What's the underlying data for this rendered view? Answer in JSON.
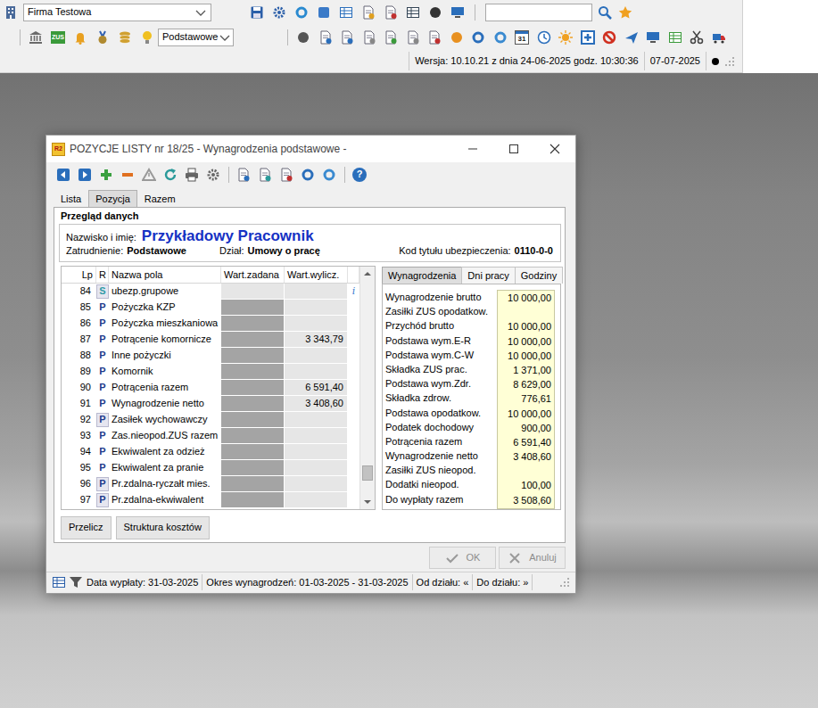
{
  "app": {
    "company": "Firma Testowa",
    "search": {
      "value": ""
    },
    "icon_texts": {
      "zus": "ZUS",
      "calendar": "31"
    },
    "view": "Podstawowe",
    "version": "Wersja: 10.10.21 z dnia 24-06-2025 godz. 10:30:36",
    "date": "07-07-2025"
  },
  "window": {
    "logo": "R2",
    "title": "POZYCJE LISTY nr 18/25 - Wynagrodzenia podstawowe -",
    "help": "?"
  },
  "tabs": [
    {
      "label": "Lista",
      "selected": false
    },
    {
      "label": "Pozycja",
      "selected": true
    },
    {
      "label": "Razem",
      "selected": false
    }
  ],
  "panel": {
    "title": "Przegląd danych"
  },
  "employee": {
    "name_label": "Nazwisko i imię:",
    "name": "Przykładowy Pracownik",
    "employment_label": "Zatrudnienie:",
    "employment": "Podstawowe",
    "department_label": "Dział:",
    "department": "Umowy o pracę",
    "code_label": "Kod tytułu ubezpieczenia:",
    "code": "0110-0-0"
  },
  "table": {
    "columns": [
      "Lp",
      "R",
      "Nazwa pola",
      "Wart.zadana",
      "Wart.wylicz."
    ],
    "rows": [
      {
        "lp": "84",
        "r": "S",
        "color": "#2f9aa6",
        "boxed": true,
        "name": "ubezp.grupowe",
        "set": "",
        "set_disabled": false,
        "calc": "",
        "note": "i"
      },
      {
        "lp": "85",
        "r": "P",
        "color": "#1b3a8c",
        "boxed": false,
        "name": "Pożyczka KZP",
        "set": "",
        "set_disabled": true,
        "calc": "",
        "note": ""
      },
      {
        "lp": "86",
        "r": "P",
        "color": "#1b3a8c",
        "boxed": false,
        "name": "Pożyczka mieszkaniowa",
        "set": "",
        "set_disabled": true,
        "calc": "",
        "note": ""
      },
      {
        "lp": "87",
        "r": "P",
        "color": "#1b3a8c",
        "boxed": false,
        "name": "Potrącenie komornicze",
        "set": "",
        "set_disabled": true,
        "calc": "3 343,79",
        "note": ""
      },
      {
        "lp": "88",
        "r": "P",
        "color": "#1b3a8c",
        "boxed": false,
        "name": "Inne pożyczki",
        "set": "",
        "set_disabled": true,
        "calc": "",
        "note": ""
      },
      {
        "lp": "89",
        "r": "P",
        "color": "#1b3a8c",
        "boxed": false,
        "name": "Komornik",
        "set": "",
        "set_disabled": true,
        "calc": "",
        "note": ""
      },
      {
        "lp": "90",
        "r": "P",
        "color": "#1b3a8c",
        "boxed": false,
        "name": "Potrącenia razem",
        "set": "",
        "set_disabled": true,
        "calc": "6 591,40",
        "note": ""
      },
      {
        "lp": "91",
        "r": "P",
        "color": "#1b3a8c",
        "boxed": false,
        "name": "Wynagrodzenie netto",
        "set": "",
        "set_disabled": true,
        "calc": "3 408,60",
        "note": ""
      },
      {
        "lp": "92",
        "r": "P",
        "color": "#1b3a8c",
        "boxed": true,
        "name": "Zasiłek wychowawczy",
        "set": "",
        "set_disabled": true,
        "calc": "",
        "note": ""
      },
      {
        "lp": "93",
        "r": "P",
        "color": "#1b3a8c",
        "boxed": false,
        "name": "Zas.nieopod.ZUS razem",
        "set": "",
        "set_disabled": true,
        "calc": "",
        "note": ""
      },
      {
        "lp": "94",
        "r": "P",
        "color": "#1b3a8c",
        "boxed": false,
        "name": "Ekwiwalent za odzież",
        "set": "",
        "set_disabled": true,
        "calc": "",
        "note": ""
      },
      {
        "lp": "95",
        "r": "P",
        "color": "#1b3a8c",
        "boxed": false,
        "name": "Ekwiwalent za pranie",
        "set": "",
        "set_disabled": true,
        "calc": "",
        "note": ""
      },
      {
        "lp": "96",
        "r": "P",
        "color": "#1b3a8c",
        "boxed": true,
        "name": "Pr.zdalna-ryczałt mies.",
        "set": "",
        "set_disabled": true,
        "calc": "",
        "note": ""
      },
      {
        "lp": "97",
        "r": "P",
        "color": "#1b3a8c",
        "boxed": true,
        "name": "Pr.zdalna-ekwiwalent",
        "set": "",
        "set_disabled": true,
        "calc": "",
        "note": ""
      }
    ],
    "scrollbar": {
      "level": 0.93
    }
  },
  "side_tabs": [
    {
      "label": "Wynagrodzenia",
      "selected": true
    },
    {
      "label": "Dni pracy",
      "selected": false
    },
    {
      "label": "Godziny",
      "selected": false
    }
  ],
  "side_items": [
    {
      "label": "Wynagrodzenie brutto",
      "value": "10 000,00"
    },
    {
      "label": "Zasiłki ZUS opodatkow.",
      "value": ""
    },
    {
      "label": "Przychód brutto",
      "value": "10 000,00"
    },
    {
      "label": "Podstawa wym.E-R",
      "value": "10 000,00"
    },
    {
      "label": "Podstawa wym.C-W",
      "value": "10 000,00"
    },
    {
      "label": "Składka ZUS prac.",
      "value": "1 371,00"
    },
    {
      "label": "Podstawa wym.Zdr.",
      "value": "8 629,00"
    },
    {
      "label": "Składka zdrow.",
      "value": "776,61"
    },
    {
      "label": "Podstawa opodatkow.",
      "value": "10 000,00"
    },
    {
      "label": "Podatek dochodowy",
      "value": "900,00"
    },
    {
      "label": "Potrącenia razem",
      "value": "6 591,40"
    },
    {
      "label": "Wynagrodzenie netto",
      "value": "3 408,60"
    },
    {
      "label": "Zasiłki ZUS nieopod.",
      "value": ""
    },
    {
      "label": "Dodatki nieopod.",
      "value": "100,00"
    },
    {
      "label": "Do wypłaty razem",
      "value": "3 508,60"
    }
  ],
  "actions": [
    {
      "label": "Przelicz"
    },
    {
      "label": "Struktura kosztów"
    }
  ],
  "dialog_buttons": [
    {
      "label": "OK",
      "disabled": true
    },
    {
      "label": "Anuluj",
      "disabled": true
    }
  ],
  "status_bar": [
    "Data wypłaty: 31-03-2025",
    "Okres wynagrodzeń: 01-03-2025 - 31-03-2025",
    "Od działu: «",
    "Do działu: »"
  ]
}
